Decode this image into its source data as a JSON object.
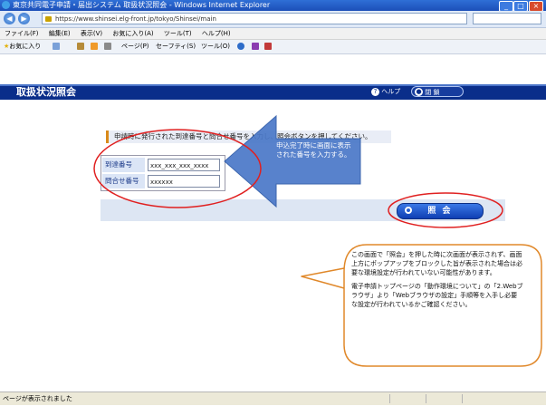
{
  "window": {
    "title": "東京共同電子申請・届出システム  取扱状況照会 - Windows Internet Explorer",
    "url": "https://www.shinsei.elg-front.jp/tokyo/Shinsei/main"
  },
  "menu": {
    "items": [
      "ファイル(F)",
      "編集(E)",
      "表示(V)",
      "お気に入り(A)",
      "ツール(T)",
      "ヘルプ(H)"
    ]
  },
  "toolbar": {
    "favorites": "お気に入り",
    "page": "ページ(P)",
    "safety": "セーフティ(S)",
    "tools": "ツール(O)"
  },
  "app": {
    "title": "取扱状況照会",
    "help": "ヘルプ",
    "close": "閉 鎖"
  },
  "form": {
    "instruction": "申請時に発行された到達番号と問合せ番号を入力し、照会ボタンを押してください。",
    "arrival_label": "到達番号",
    "arrival_value": "xxx_xxx_xxx_xxxx",
    "inquiry_label": "問合せ番号",
    "inquiry_value": "xxxxxx",
    "submit": "照 会"
  },
  "callouts": {
    "arrow_text": "申込完了時に画面に表示された番号を入力する。",
    "note_p1": "この画面で「照会」を押した時に次画面が表示されず、画面上方にポップアップをブロックした旨が表示された場合は必要な環境設定が行われていない可能性があります。",
    "note_p2": "電子申請トップページの「動作環境について」の「2.Webブラウザ」より「Webブラウザの設定」手順等を入手し必要な設定が行われているかご確認ください。"
  },
  "status": {
    "text": "ページが表示されました"
  }
}
